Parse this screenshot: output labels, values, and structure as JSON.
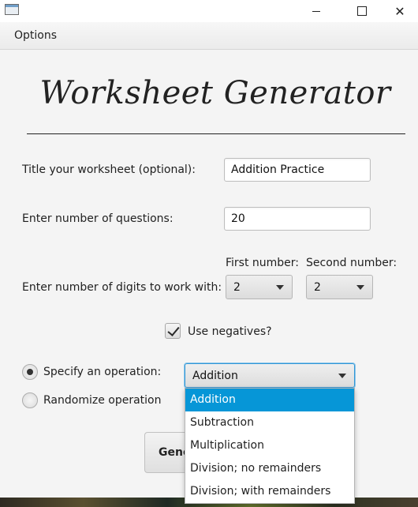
{
  "window": {
    "minimize_glyph": "",
    "maximize_glyph": "",
    "close_glyph": "✕"
  },
  "menu": {
    "options_label": "Options"
  },
  "header": {
    "title": "Worksheet Generator"
  },
  "form": {
    "title_label": "Title your worksheet (optional):",
    "title_value": "Addition Practice",
    "questions_label": "Enter number of questions:",
    "questions_value": "20",
    "digits_label": "Enter number of digits to work with:",
    "first_number_label": "First number:",
    "first_number_value": "2",
    "second_number_label": "Second number:",
    "second_number_value": "2",
    "negatives_label": "Use negatives?",
    "negatives_checked": true,
    "specify_operation_label": "Specify an operation:",
    "randomize_operation_label": "Randomize operation",
    "operation_selected": "Addition",
    "operation_options": [
      "Addition",
      "Subtraction",
      "Multiplication",
      "Division; no remainders",
      "Division; with remainders"
    ],
    "generate_button_label": "Generate"
  },
  "colors": {
    "accent": "#0696d7",
    "focus_ring": "#2f96d6",
    "background": "#f4f4f4"
  }
}
